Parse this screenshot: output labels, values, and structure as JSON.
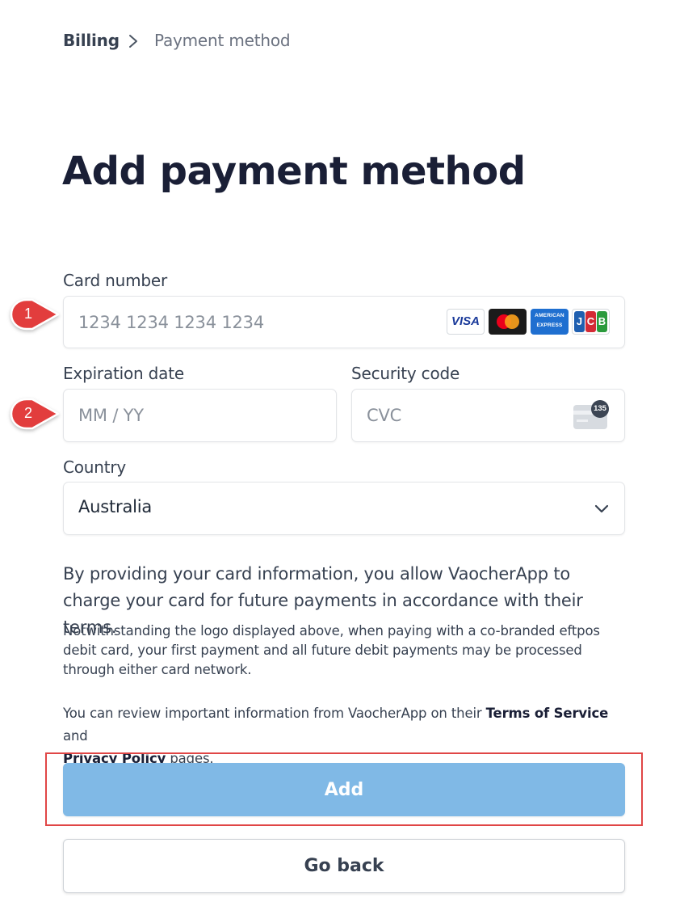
{
  "breadcrumb": {
    "parent": "Billing",
    "current": "Payment method"
  },
  "page": {
    "title": "Add payment method"
  },
  "form": {
    "card_number": {
      "label": "Card number",
      "placeholder": "1234 1234 1234 1234",
      "value": ""
    },
    "card_brands": {
      "visa": "VISA",
      "amex_top": "AMERICAN",
      "amex_bottom": "EXPRESS",
      "jcb": [
        "J",
        "C",
        "B"
      ]
    },
    "expiration": {
      "label": "Expiration date",
      "placeholder": "MM / YY",
      "value": ""
    },
    "security_code": {
      "label": "Security code",
      "placeholder": "CVC",
      "value": "",
      "hint_badge": "135"
    },
    "country": {
      "label": "Country",
      "selected": "Australia"
    }
  },
  "consent": {
    "main": "By providing your card information, you allow VaocherApp to charge your card for future payments in accordance with their terms.",
    "eftpos": "Notwithstanding the logo displayed above, when paying with a co-branded eftpos debit card, your first payment and all future debit payments may be processed through either card network.",
    "review_prefix": "You can review important information from VaocherApp on their ",
    "terms_link": "Terms of Service",
    "review_and": " and",
    "privacy_link": "Privacy Policy",
    "review_suffix": " pages."
  },
  "actions": {
    "add_label": "Add",
    "back_label": "Go back"
  },
  "annotations": {
    "callout_1": "1",
    "callout_2": "2"
  },
  "colors": {
    "primary_button": "#80b9e6",
    "annotation_red": "#e04646",
    "title": "#1a1f36"
  }
}
